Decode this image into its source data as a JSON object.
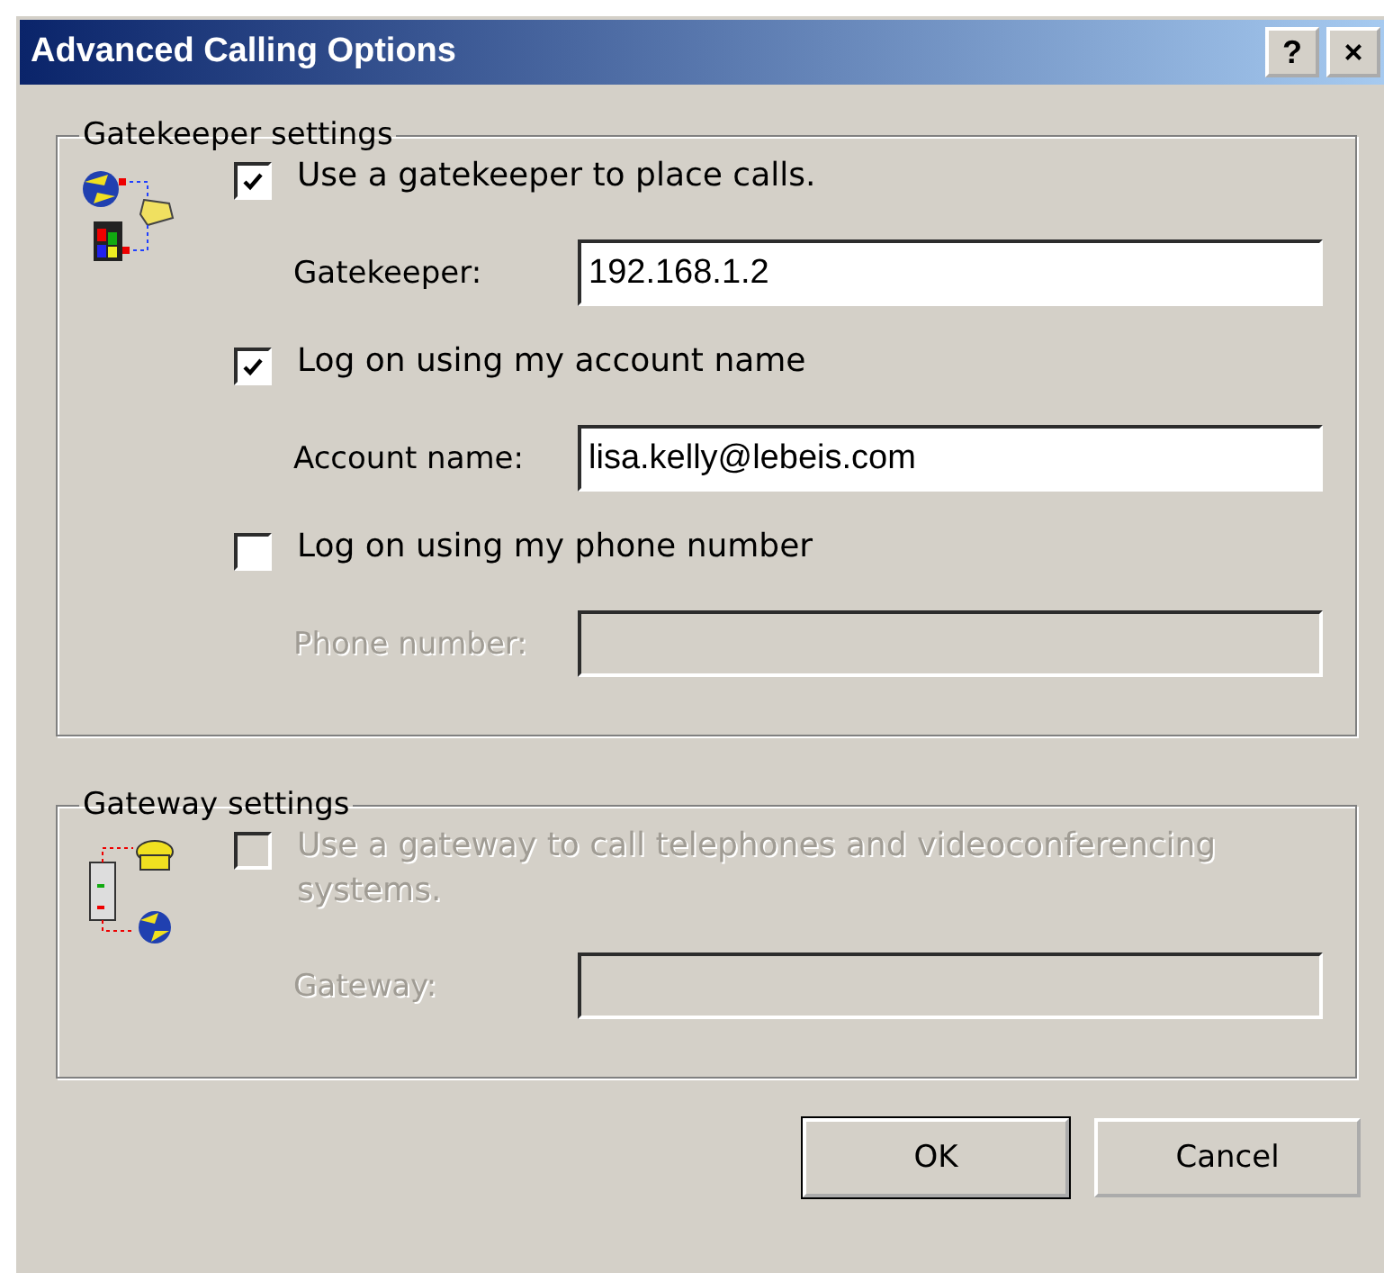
{
  "window": {
    "title": "Advanced Calling Options",
    "buttons": [
      "?",
      "×"
    ]
  },
  "groups": [
    {
      "title": "Gatekeeper settings",
      "rows": [
        {
          "kind": "checkbox",
          "label": "Use a gatekeeper to place calls.",
          "checked": true,
          "disabled": false
        },
        {
          "kind": "field",
          "label": "Gatekeeper:",
          "value": "192.168.1.2",
          "disabled": false
        },
        {
          "kind": "checkbox",
          "label": "Log on using my account name",
          "checked": true,
          "disabled": false
        },
        {
          "kind": "field",
          "label": "Account name:",
          "value": "lisa.kelly@lebeis.com",
          "disabled": false
        },
        {
          "kind": "checkbox",
          "label": "Log on using my phone number",
          "checked": false,
          "disabled": false
        },
        {
          "kind": "field",
          "label": "Phone number:",
          "value": "",
          "disabled": true
        }
      ]
    },
    {
      "title": "Gateway settings",
      "rows": [
        {
          "kind": "checkbox",
          "label": "Use a gateway to call telephones and videoconferencing systems.",
          "checked": false,
          "disabled": true
        },
        {
          "kind": "field",
          "label": "Gateway:",
          "value": "",
          "disabled": true
        }
      ]
    }
  ],
  "buttons": [
    {
      "label": "OK",
      "default": true
    },
    {
      "label": "Cancel",
      "default": false
    }
  ]
}
